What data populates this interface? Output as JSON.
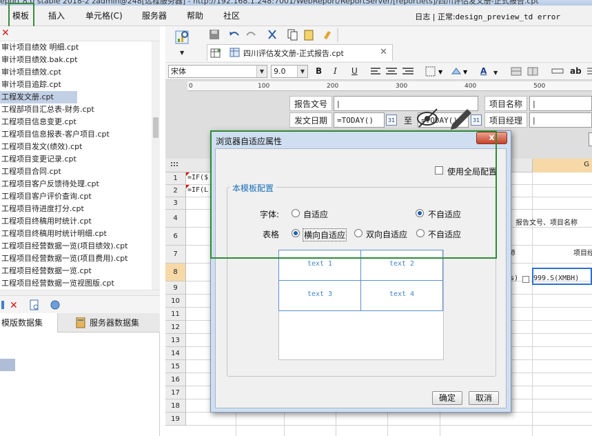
{
  "window": {
    "title_partial": "eport 8.0 stable 2018-2 zadmin@248[远程服务器] - http://192.168.1.248:7001/WebReport/ReportServer/[reportlets]/四川评估发文册-正式报告.cpt"
  },
  "menubar": {
    "items": [
      "模板",
      "插入",
      "单元格(C)",
      "服务器",
      "帮助",
      "社区"
    ],
    "status_log": "日志",
    "status_sep": "|",
    "status_label": "正常:",
    "status_detail": "design_preview_td error"
  },
  "left_panel": {
    "files": [
      "审计项目绩效 明细.cpt",
      "审计项目绩效.bak.cpt",
      "审计项目绩效.cpt",
      "审计项目追踪.cpt",
      "工程发文册.cpt",
      "工程部项目汇总表-财务.cpt",
      "工程项目信息变更.cpt",
      "工程项目信息报表-客户项目.cpt",
      "工程项目发文(绩效).cpt",
      "工程项目变更记录.cpt",
      "工程项目合同.cpt",
      "工程项目客户反馈待处理.cpt",
      "工程项目客户评价查询.cpt",
      "工程项目待进度打分.cpt",
      "工程项目终稿用时统计.cpt",
      "工程项目终稿用时统计明细.cpt",
      "工程项目经营数据一览(项目绩效).cpt",
      "工程项目经营数据一览(项目费用).cpt",
      "工程项目经营数据一览.cpt",
      "工程项目经营数据一览视图版.cpt"
    ],
    "selected_index": 4,
    "tabs": {
      "template_dataset": "模版数据集",
      "server_dataset": "服务器数据集"
    }
  },
  "document": {
    "tab_title": "四川评估发文册-正式报告.cpt"
  },
  "format_toolbar": {
    "font_family": "宋体",
    "font_size": "9.0",
    "bold": "B",
    "italic": "I",
    "underline": "U",
    "font_color_letter": "A",
    "ab_label": "ab"
  },
  "ruler": {
    "ticks": [
      "0",
      "100",
      "200",
      "300",
      "400",
      "500"
    ]
  },
  "param_pane": {
    "report_no_label": "报告文号",
    "project_name_label": "项目名称",
    "issue_date_label": "发文日期",
    "date_from": "=TODAY()",
    "to_label": "至",
    "date_to": "=TODAY()",
    "project_manager_label": "项目经理",
    "cal_label": "31"
  },
  "grid": {
    "col_g_label": "G",
    "rows": [
      "1",
      "2",
      "3",
      "4",
      "6",
      "7",
      "8",
      "9",
      "10",
      "11",
      "12",
      "13",
      "14",
      "15",
      "16",
      "17",
      "18",
      "19"
    ],
    "active_row": "8",
    "cell_a1": "=IF($",
    "cell_a2": "=IF(L",
    "cell_row4_right": "报告文号、项目名称",
    "cell_row6_mid": "师",
    "cell_row6_right": "项目经",
    "cell_row8_paren": "s)",
    "cell_row8_value": "999.S(XMBH)"
  },
  "dialog": {
    "title": "浏览器自适应属性",
    "close_label": "x",
    "use_global": "使用全局配置",
    "group_title": "本模板配置",
    "font_label": "字体:",
    "font_options": [
      "自适应",
      "不自适应"
    ],
    "font_selected": 1,
    "table_label": "表格",
    "table_options": [
      "横向自适应",
      "双向自适应",
      "不自适应"
    ],
    "table_selected": 0,
    "preview_cells": [
      "text 1",
      "text 2",
      "text 3",
      "text 4"
    ],
    "ok_label": "确定",
    "cancel_label": "取消"
  },
  "colors": {
    "accent_green": "#2f8a35",
    "active_header": "#f6d9a6",
    "link_blue": "#1a6fb7"
  }
}
